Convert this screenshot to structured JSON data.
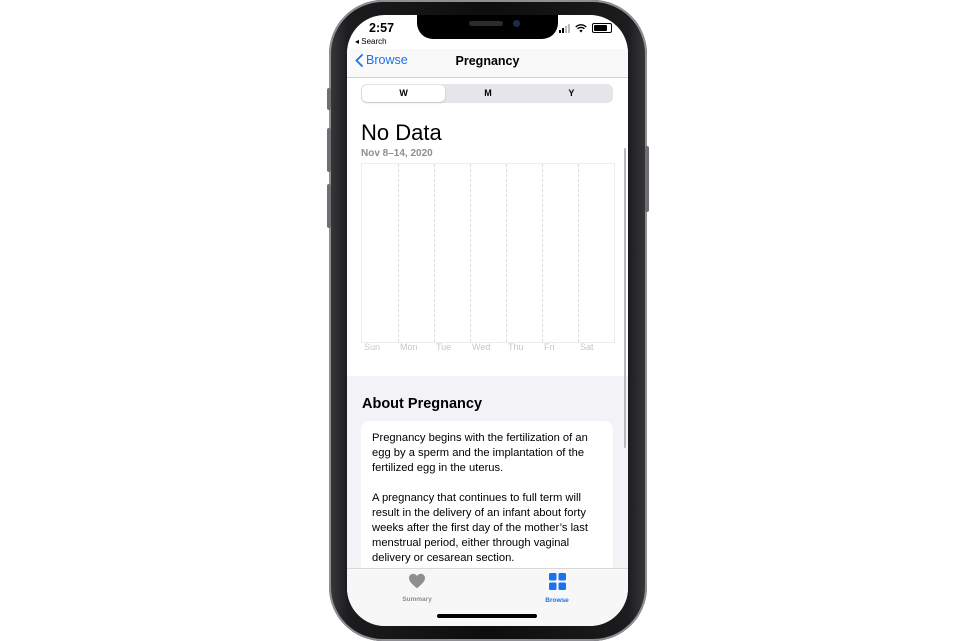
{
  "status_bar": {
    "time": "2:57",
    "back_app": "◂ Search"
  },
  "nav": {
    "back_label": "Browse",
    "title": "Pregnancy"
  },
  "segments": [
    "W",
    "M",
    "Y"
  ],
  "selected_segment": "W",
  "summary": {
    "headline": "No Data",
    "date_range": "Nov 8–14, 2020"
  },
  "chart_data": {
    "type": "bar",
    "categories": [
      "Sun",
      "Mon",
      "Tue",
      "Wed",
      "Thu",
      "Fri",
      "Sat"
    ],
    "series": []
  },
  "about": {
    "title": "About Pregnancy",
    "paragraphs": [
      "Pregnancy begins with the fertilization of an egg by a sperm and the implantation of the fertilized egg in the uterus.",
      "A pregnancy that continues to full term will result in the delivery of an infant about forty weeks after the first day of the mother’s last menstrual period, either through vaginal delivery or cesarean section."
    ]
  },
  "tabbar": {
    "items": [
      {
        "label": "Summary",
        "icon": "heart-icon",
        "active": false
      },
      {
        "label": "Browse",
        "icon": "grid-icon",
        "active": true
      }
    ]
  },
  "colors": {
    "accent": "#1a73e8",
    "inactive_tab": "#8e8e93"
  }
}
